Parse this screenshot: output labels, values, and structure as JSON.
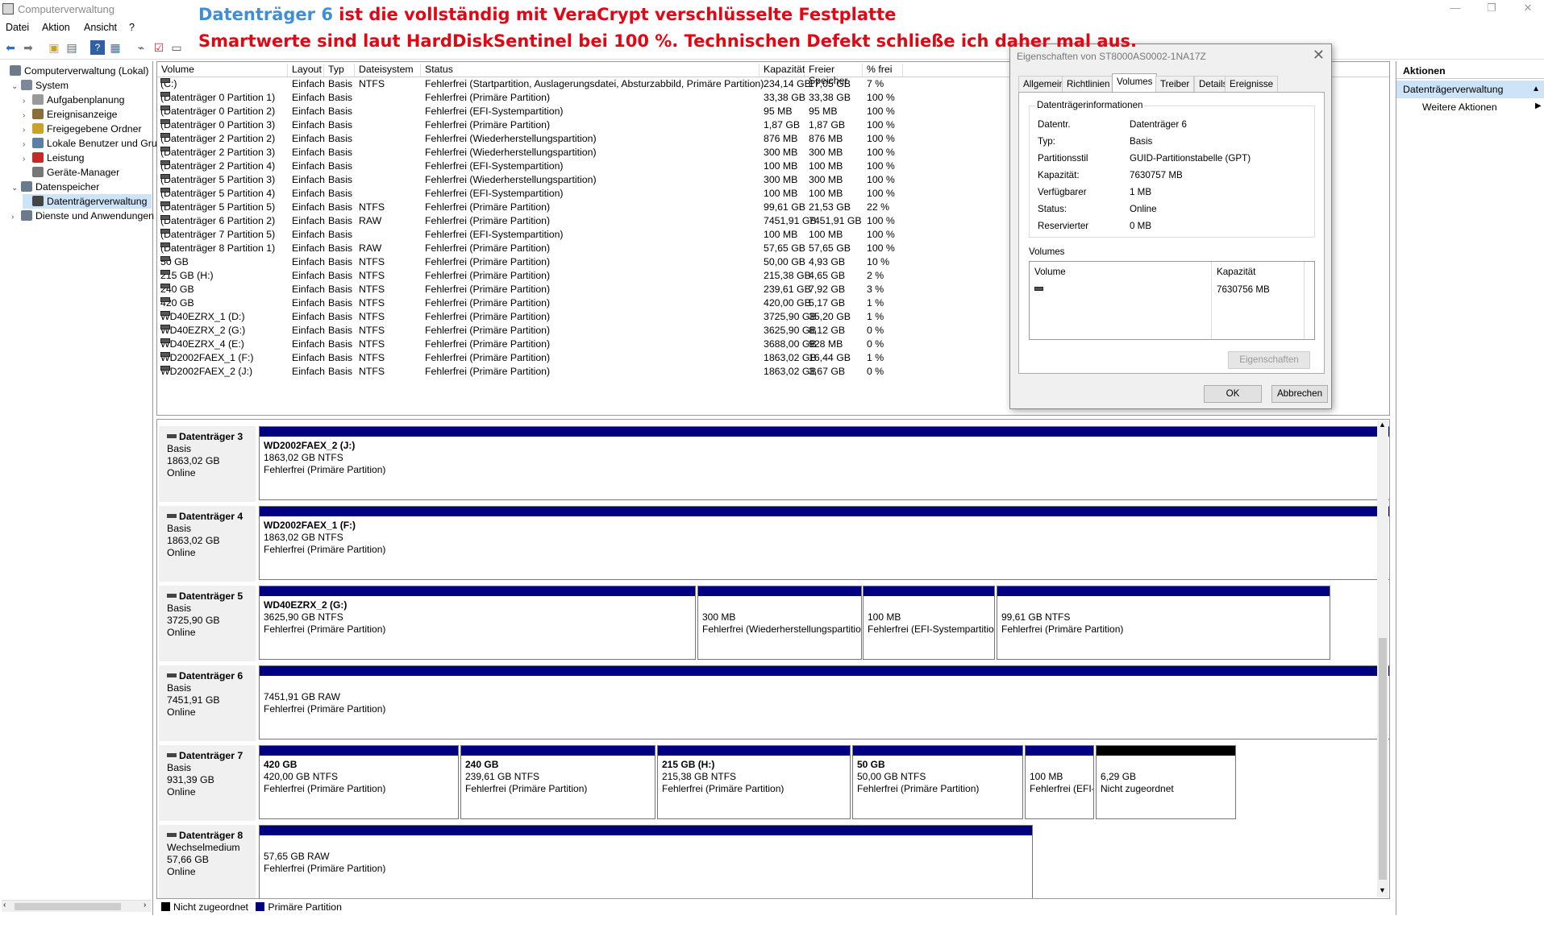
{
  "app": {
    "title": "Computerverwaltung"
  },
  "annotation": {
    "line1_highlight": "Datenträger 6",
    "line1_rest": " ist die vollständig mit VeraCrypt verschlüsselte Festplatte",
    "line2": "Smartwerte sind laut HardDiskSentinel bei 100 %. Technischen Defekt schließe ich daher mal aus."
  },
  "menu": [
    "Datei",
    "Aktion",
    "Ansicht",
    "?"
  ],
  "tree": [
    {
      "label": "Computerverwaltung (Lokal)",
      "toggle": "",
      "indent": 0
    },
    {
      "label": "System",
      "toggle": "⌄",
      "indent": 1
    },
    {
      "label": "Aufgabenplanung",
      "toggle": "›",
      "indent": 2
    },
    {
      "label": "Ereignisanzeige",
      "toggle": "›",
      "indent": 2
    },
    {
      "label": "Freigegebene Ordner",
      "toggle": "›",
      "indent": 2
    },
    {
      "label": "Lokale Benutzer und Gruppen",
      "toggle": "›",
      "indent": 2
    },
    {
      "label": "Leistung",
      "toggle": "›",
      "indent": 2
    },
    {
      "label": "Geräte-Manager",
      "toggle": "",
      "indent": 2
    },
    {
      "label": "Datenspeicher",
      "toggle": "⌄",
      "indent": 1
    },
    {
      "label": "Datenträgerverwaltung",
      "toggle": "",
      "indent": 2,
      "selected": true
    },
    {
      "label": "Dienste und Anwendungen",
      "toggle": "›",
      "indent": 1
    }
  ],
  "columns": [
    "Volume",
    "Layout",
    "Typ",
    "Dateisystem",
    "Status",
    "Kapazität",
    "Freier Speicher",
    "% frei"
  ],
  "volumes": [
    [
      "(C:)",
      "Einfach",
      "Basis",
      "NTFS",
      "Fehlerfrei (Startpartition, Auslagerungsdatei, Absturzabbild, Primäre Partition)",
      "234,14 GB",
      "17,05 GB",
      "7 %"
    ],
    [
      "(Datenträger 0 Partition 1)",
      "Einfach",
      "Basis",
      "",
      "Fehlerfrei (Primäre Partition)",
      "33,38 GB",
      "33,38 GB",
      "100 %"
    ],
    [
      "(Datenträger 0 Partition 2)",
      "Einfach",
      "Basis",
      "",
      "Fehlerfrei (EFI-Systempartition)",
      "95 MB",
      "95 MB",
      "100 %"
    ],
    [
      "(Datenträger 0 Partition 3)",
      "Einfach",
      "Basis",
      "",
      "Fehlerfrei (Primäre Partition)",
      "1,87 GB",
      "1,87 GB",
      "100 %"
    ],
    [
      "(Datenträger 2 Partition 2)",
      "Einfach",
      "Basis",
      "",
      "Fehlerfrei (Wiederherstellungspartition)",
      "876 MB",
      "876 MB",
      "100 %"
    ],
    [
      "(Datenträger 2 Partition 3)",
      "Einfach",
      "Basis",
      "",
      "Fehlerfrei (Wiederherstellungspartition)",
      "300 MB",
      "300 MB",
      "100 %"
    ],
    [
      "(Datenträger 2 Partition 4)",
      "Einfach",
      "Basis",
      "",
      "Fehlerfrei (EFI-Systempartition)",
      "100 MB",
      "100 MB",
      "100 %"
    ],
    [
      "(Datenträger 5 Partition 3)",
      "Einfach",
      "Basis",
      "",
      "Fehlerfrei (Wiederherstellungspartition)",
      "300 MB",
      "300 MB",
      "100 %"
    ],
    [
      "(Datenträger 5 Partition 4)",
      "Einfach",
      "Basis",
      "",
      "Fehlerfrei (EFI-Systempartition)",
      "100 MB",
      "100 MB",
      "100 %"
    ],
    [
      "(Datenträger 5 Partition 5)",
      "Einfach",
      "Basis",
      "NTFS",
      "Fehlerfrei (Primäre Partition)",
      "99,61 GB",
      "21,53 GB",
      "22 %"
    ],
    [
      "(Datenträger 6 Partition 2)",
      "Einfach",
      "Basis",
      "RAW",
      "Fehlerfrei (Primäre Partition)",
      "7451,91 GB",
      "7451,91 GB",
      "100 %"
    ],
    [
      "(Datenträger 7 Partition 5)",
      "Einfach",
      "Basis",
      "",
      "Fehlerfrei (EFI-Systempartition)",
      "100 MB",
      "100 MB",
      "100 %"
    ],
    [
      "(Datenträger 8 Partition 1)",
      "Einfach",
      "Basis",
      "RAW",
      "Fehlerfrei (Primäre Partition)",
      "57,65 GB",
      "57,65 GB",
      "100 %"
    ],
    [
      "50 GB",
      "Einfach",
      "Basis",
      "NTFS",
      "Fehlerfrei (Primäre Partition)",
      "50,00 GB",
      "4,93 GB",
      "10 %"
    ],
    [
      "215 GB (H:)",
      "Einfach",
      "Basis",
      "NTFS",
      "Fehlerfrei (Primäre Partition)",
      "215,38 GB",
      "4,65 GB",
      "2 %"
    ],
    [
      "240 GB",
      "Einfach",
      "Basis",
      "NTFS",
      "Fehlerfrei (Primäre Partition)",
      "239,61 GB",
      "7,92 GB",
      "3 %"
    ],
    [
      "420 GB",
      "Einfach",
      "Basis",
      "NTFS",
      "Fehlerfrei (Primäre Partition)",
      "420,00 GB",
      "5,17 GB",
      "1 %"
    ],
    [
      "WD40EZRX_1 (D:)",
      "Einfach",
      "Basis",
      "NTFS",
      "Fehlerfrei (Primäre Partition)",
      "3725,90 GB",
      "35,20 GB",
      "1 %"
    ],
    [
      "WD40EZRX_2 (G:)",
      "Einfach",
      "Basis",
      "NTFS",
      "Fehlerfrei (Primäre Partition)",
      "3625,90 GB",
      "8,12 GB",
      "0 %"
    ],
    [
      "WD40EZRX_4 (E:)",
      "Einfach",
      "Basis",
      "NTFS",
      "Fehlerfrei (Primäre Partition)",
      "3688,00 GB",
      "928 MB",
      "0 %"
    ],
    [
      "WD2002FAEX_1 (F:)",
      "Einfach",
      "Basis",
      "NTFS",
      "Fehlerfrei (Primäre Partition)",
      "1863,02 GB",
      "16,44 GB",
      "1 %"
    ],
    [
      "WD2002FAEX_2 (J:)",
      "Einfach",
      "Basis",
      "NTFS",
      "Fehlerfrei (Primäre Partition)",
      "1863,02 GB",
      "3,67 GB",
      "0 %"
    ]
  ],
  "disks": [
    {
      "name": "Datenträger 3",
      "type": "Basis",
      "size": "1863,02 GB",
      "state": "Online",
      "parts": [
        {
          "title": "WD2002FAEX_2  (J:)",
          "size": "1863,02 GB NTFS",
          "status": "Fehlerfrei (Primäre Partition)"
        }
      ]
    },
    {
      "name": "Datenträger 4",
      "type": "Basis",
      "size": "1863,02 GB",
      "state": "Online",
      "parts": [
        {
          "title": "WD2002FAEX_1  (F:)",
          "size": "1863,02 GB NTFS",
          "status": "Fehlerfrei (Primäre Partition)"
        }
      ]
    },
    {
      "name": "Datenträger 5",
      "type": "Basis",
      "size": "3725,90 GB",
      "state": "Online",
      "parts": [
        {
          "title": "WD40EZRX_2  (G:)",
          "size": "3625,90 GB NTFS",
          "status": "Fehlerfrei (Primäre Partition)"
        },
        {
          "title": "",
          "size": "300 MB",
          "status": "Fehlerfrei (Wiederherstellungspartition)"
        },
        {
          "title": "",
          "size": "100 MB",
          "status": "Fehlerfrei (EFI-Systempartition)"
        },
        {
          "title": "",
          "size": "99,61 GB NTFS",
          "status": "Fehlerfrei (Primäre Partition)"
        }
      ]
    },
    {
      "name": "Datenträger 6",
      "type": "Basis",
      "size": "7451,91 GB",
      "state": "Online",
      "parts": [
        {
          "title": "",
          "size": "7451,91 GB RAW",
          "status": "Fehlerfrei (Primäre Partition)"
        }
      ]
    },
    {
      "name": "Datenträger 7",
      "type": "Basis",
      "size": "931,39 GB",
      "state": "Online",
      "parts": [
        {
          "title": "420 GB",
          "size": "420,00 GB NTFS",
          "status": "Fehlerfrei (Primäre Partition)"
        },
        {
          "title": "240 GB",
          "size": "239,61 GB NTFS",
          "status": "Fehlerfrei (Primäre Partition)"
        },
        {
          "title": "215 GB  (H:)",
          "size": "215,38 GB NTFS",
          "status": "Fehlerfrei (Primäre Partition)"
        },
        {
          "title": "50 GB",
          "size": "50,00 GB NTFS",
          "status": "Fehlerfrei (Primäre Partition)"
        },
        {
          "title": "",
          "size": "100 MB",
          "status": "Fehlerfrei (EFI-Systempartition)"
        },
        {
          "title": "",
          "size": "6,29 GB",
          "status": "Nicht zugeordnet",
          "unallocated": true
        }
      ]
    },
    {
      "name": "Datenträger 8",
      "type": "Wechselmedium",
      "size": "57,66 GB",
      "state": "Online",
      "parts": [
        {
          "title": "",
          "size": "57,65 GB RAW",
          "status": "Fehlerfrei (Primäre Partition)"
        }
      ]
    }
  ],
  "legend": {
    "unallocated": "Nicht zugeordnet",
    "primary": "Primäre Partition",
    "colors": {
      "unallocated": "#000000",
      "primary": "#000080"
    }
  },
  "actions": {
    "header": "Aktionen",
    "selected": "Datenträgerverwaltung",
    "more": "Weitere Aktionen"
  },
  "dialog": {
    "title": "Eigenschaften von ST8000AS0002-1NA17Z",
    "tabs": [
      "Allgemein",
      "Richtlinien",
      "Volumes",
      "Treiber",
      "Details",
      "Ereignisse"
    ],
    "active_tab": "Volumes",
    "group_title": "Datenträgerinformationen",
    "info": [
      [
        "Datentr.",
        "Datenträger 6"
      ],
      [
        "Typ:",
        "Basis"
      ],
      [
        "Partitionsstil",
        "GUID-Partitionstabelle (GPT)"
      ],
      [
        "Kapazität:",
        "7630757 MB"
      ],
      [
        "Verfügbarer",
        "1 MB"
      ],
      [
        "Status:",
        "Online"
      ],
      [
        "Reservierter",
        "0 MB"
      ]
    ],
    "volumes_label": "Volumes",
    "vol_col1": "Volume",
    "vol_col2": "Kapazität",
    "vol_row_cap": "7630756 MB",
    "btn_properties": "Eigenschaften",
    "btn_ok": "OK",
    "btn_cancel": "Abbrechen"
  }
}
